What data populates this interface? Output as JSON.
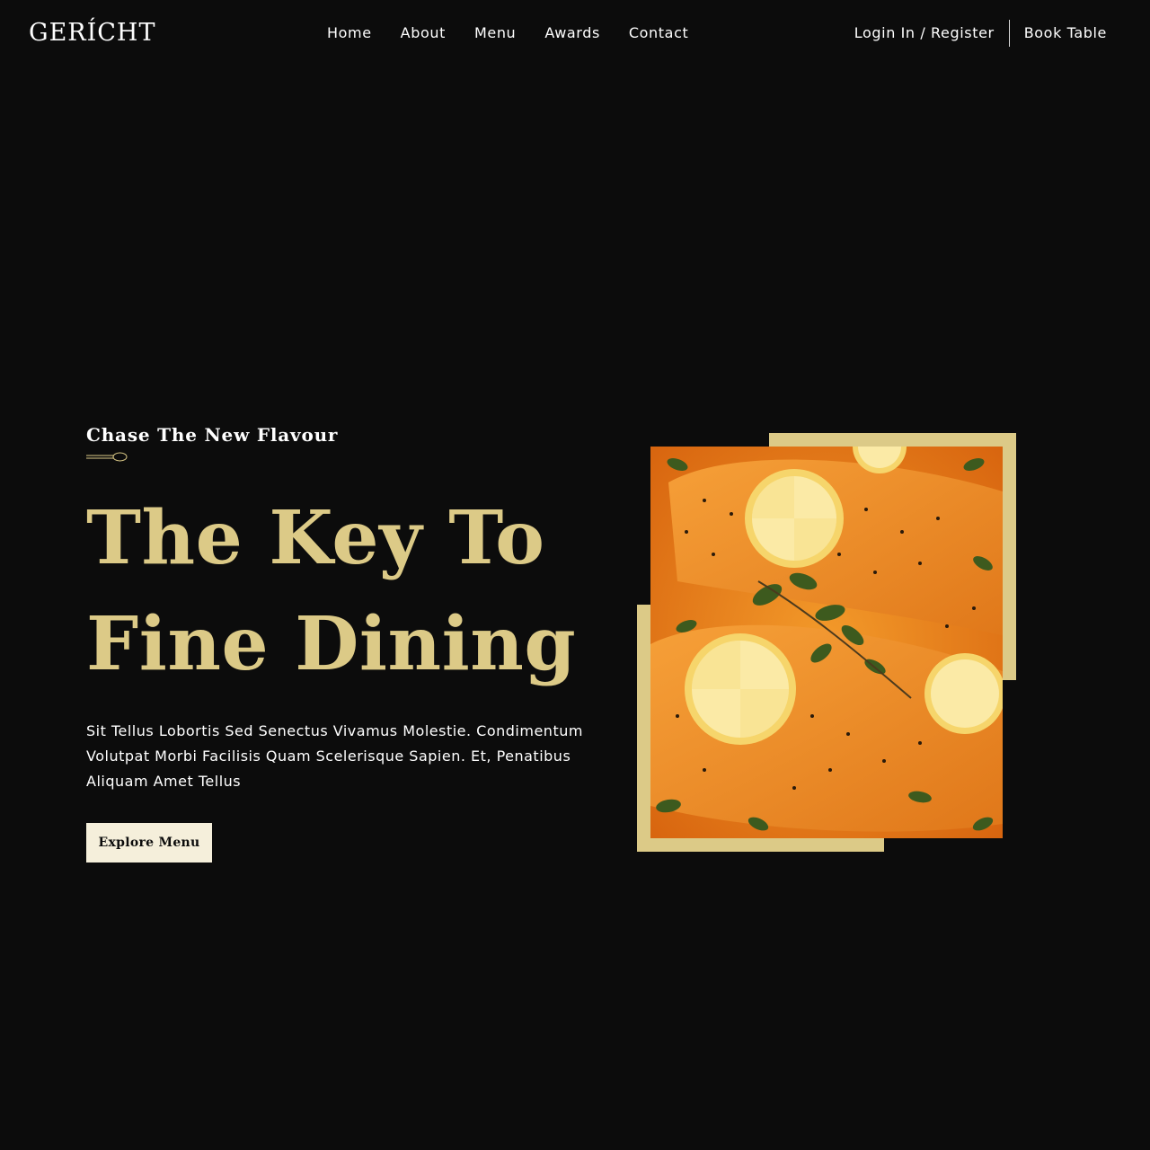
{
  "navbar": {
    "logo": "GERÍCHT",
    "links": [
      "Home",
      "About",
      "Menu",
      "Awards",
      "Contact"
    ],
    "login_label": "Login In / Register",
    "book_label": "Book Table"
  },
  "hero": {
    "subtitle": "Chase The New Flavour",
    "headline_line1": "The Key To",
    "headline_line2": "Fine Dining",
    "body": "Sit Tellus Lobortis Sed Senectus Vivamus Molestie. Condimentum Volutpat Morbi Facilisis Quam Scelerisque Sapien. Et, Penatibus Aliquam Amet Tellus",
    "cta_label": "Explore Menu"
  },
  "colors": {
    "background": "#0c0c0c",
    "gold": "#dcca87",
    "cream": "#f5efdb",
    "white": "#ffffff"
  },
  "icons": {
    "spoon": "spoon-icon"
  }
}
